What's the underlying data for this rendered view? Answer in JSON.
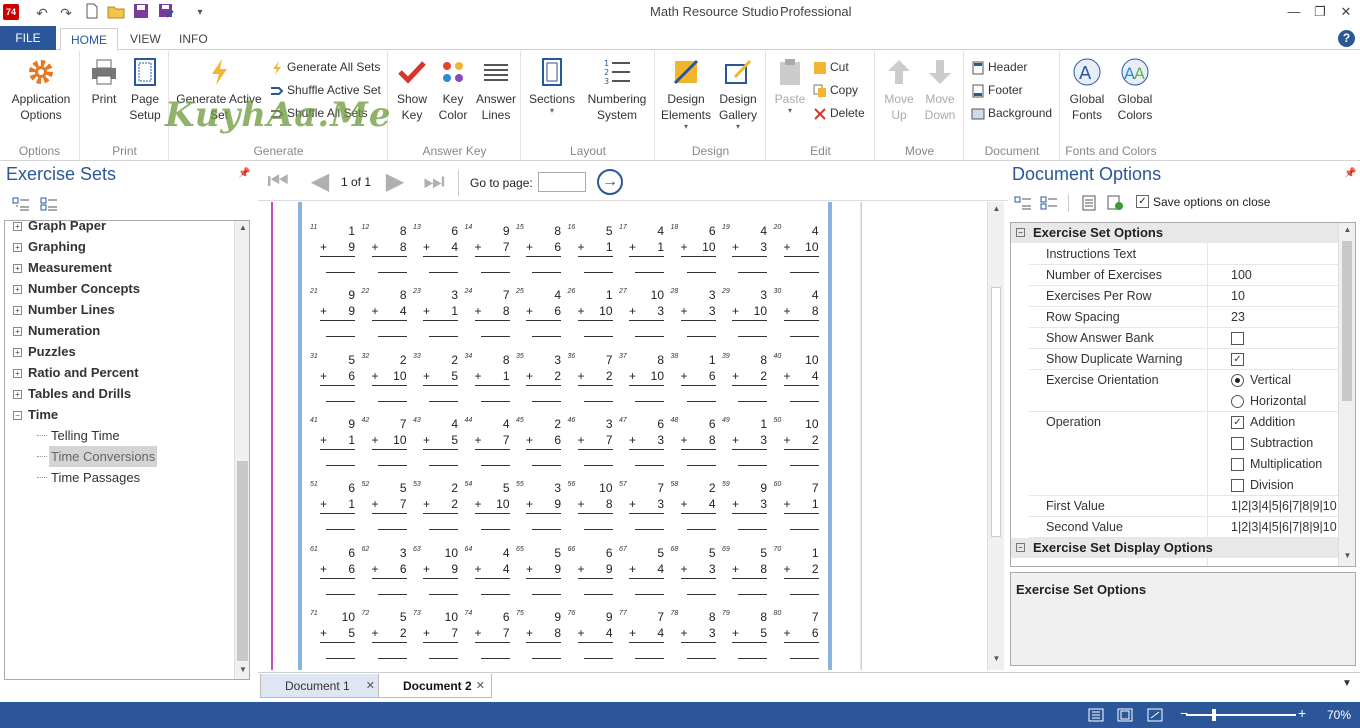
{
  "app": {
    "title": "Math Resource Studio",
    "edition": "Professional",
    "icon_text": "74",
    "window_controls": {
      "minimize": "—",
      "restore": "❐",
      "close": "✕"
    }
  },
  "ribbon_tabs": {
    "file": "FILE",
    "home": "HOME",
    "view": "VIEW",
    "info": "INFO"
  },
  "ribbon": {
    "options": {
      "label": "Options",
      "app_options": "Application Options"
    },
    "print": {
      "label": "Print",
      "print": "Print",
      "page_setup": "Page Setup"
    },
    "generate": {
      "label": "Generate",
      "generate_active": "Generate Active Set",
      "generate_all": "Generate All Sets",
      "shuffle_active": "Shuffle Active Set",
      "shuffle_all": "Shuffle All Sets"
    },
    "answer_key": {
      "label": "Answer Key",
      "show_key": "Show Key",
      "key_color": "Key Color",
      "answer_lines": "Answer Lines"
    },
    "layout": {
      "label": "Layout",
      "sections": "Sections",
      "numbering": "Numbering System"
    },
    "design": {
      "label": "Design",
      "elements": "Design Elements",
      "gallery": "Design Gallery"
    },
    "edit": {
      "label": "Edit",
      "paste": "Paste",
      "cut": "Cut",
      "copy": "Copy",
      "delete": "Delete"
    },
    "move": {
      "label": "Move",
      "up": "Move Up",
      "down": "Move Down"
    },
    "document": {
      "label": "Document",
      "header": "Header",
      "footer": "Footer",
      "background": "Background"
    },
    "fonts_colors": {
      "label": "Fonts and Colors",
      "global_fonts": "Global Fonts",
      "global_colors": "Global Colors"
    },
    "watermark": "KuyhAa.Me"
  },
  "left_panel": {
    "title": "Exercise Sets",
    "tree": [
      {
        "label": "Graph Paper",
        "type": "folder",
        "expander": "⊞"
      },
      {
        "label": "Graphing",
        "type": "folder",
        "expander": "⊞"
      },
      {
        "label": "Measurement",
        "type": "folder",
        "expander": "⊞"
      },
      {
        "label": "Number Concepts",
        "type": "folder",
        "expander": "⊞"
      },
      {
        "label": "Number Lines",
        "type": "folder",
        "expander": "⊞"
      },
      {
        "label": "Numeration",
        "type": "folder",
        "expander": "⊞"
      },
      {
        "label": "Puzzles",
        "type": "folder",
        "expander": "⊞"
      },
      {
        "label": "Ratio and Percent",
        "type": "folder",
        "expander": "⊞"
      },
      {
        "label": "Tables and Drills",
        "type": "folder",
        "expander": "⊞"
      },
      {
        "label": "Time",
        "type": "folder",
        "expander": "⊟"
      },
      {
        "label": "Telling Time",
        "type": "leaf"
      },
      {
        "label": "Time Conversions",
        "type": "leaf",
        "selected": true
      },
      {
        "label": "Time Passages",
        "type": "leaf"
      }
    ]
  },
  "nav": {
    "page_info": "1 of 1",
    "goto_label": "Go to page:",
    "goto_value": ""
  },
  "worksheet": {
    "operator": "+",
    "rows": [
      [
        [
          11,
          1,
          9
        ],
        [
          12,
          8,
          8
        ],
        [
          13,
          6,
          4
        ],
        [
          14,
          9,
          7
        ],
        [
          15,
          8,
          6
        ],
        [
          16,
          5,
          1
        ],
        [
          17,
          4,
          1
        ],
        [
          18,
          6,
          10
        ],
        [
          19,
          4,
          3
        ],
        [
          20,
          4,
          10
        ]
      ],
      [
        [
          21,
          9,
          9
        ],
        [
          22,
          8,
          4
        ],
        [
          23,
          3,
          1
        ],
        [
          24,
          7,
          8
        ],
        [
          25,
          4,
          6
        ],
        [
          26,
          1,
          10
        ],
        [
          27,
          10,
          3
        ],
        [
          28,
          3,
          3
        ],
        [
          29,
          3,
          10
        ],
        [
          30,
          4,
          8
        ]
      ],
      [
        [
          31,
          5,
          6
        ],
        [
          32,
          2,
          10
        ],
        [
          33,
          2,
          5
        ],
        [
          34,
          8,
          1
        ],
        [
          35,
          3,
          2
        ],
        [
          36,
          7,
          2
        ],
        [
          37,
          8,
          10
        ],
        [
          38,
          1,
          6
        ],
        [
          39,
          8,
          2
        ],
        [
          40,
          10,
          4
        ]
      ],
      [
        [
          41,
          9,
          1
        ],
        [
          42,
          7,
          10
        ],
        [
          43,
          4,
          5
        ],
        [
          44,
          4,
          7
        ],
        [
          45,
          2,
          6
        ],
        [
          46,
          3,
          7
        ],
        [
          47,
          6,
          3
        ],
        [
          48,
          6,
          8
        ],
        [
          49,
          1,
          3
        ],
        [
          50,
          10,
          2
        ]
      ],
      [
        [
          51,
          6,
          1
        ],
        [
          52,
          5,
          7
        ],
        [
          53,
          2,
          2
        ],
        [
          54,
          5,
          10
        ],
        [
          55,
          3,
          9
        ],
        [
          56,
          10,
          8
        ],
        [
          57,
          7,
          3
        ],
        [
          58,
          2,
          4
        ],
        [
          59,
          9,
          3
        ],
        [
          60,
          7,
          1
        ]
      ],
      [
        [
          61,
          6,
          6
        ],
        [
          62,
          3,
          6
        ],
        [
          63,
          10,
          9
        ],
        [
          64,
          4,
          4
        ],
        [
          65,
          5,
          9
        ],
        [
          66,
          6,
          9
        ],
        [
          67,
          5,
          4
        ],
        [
          68,
          5,
          3
        ],
        [
          69,
          5,
          8
        ],
        [
          70,
          1,
          2
        ]
      ],
      [
        [
          71,
          10,
          5
        ],
        [
          72,
          5,
          2
        ],
        [
          73,
          10,
          7
        ],
        [
          74,
          6,
          7
        ],
        [
          75,
          9,
          8
        ],
        [
          76,
          9,
          4
        ],
        [
          77,
          7,
          4
        ],
        [
          78,
          8,
          3
        ],
        [
          79,
          8,
          5
        ],
        [
          80,
          7,
          6
        ]
      ]
    ]
  },
  "doc_tabs": [
    {
      "label": "Document 1"
    },
    {
      "label": "Document 2",
      "active": true
    }
  ],
  "right_panel": {
    "title": "Document Options",
    "save_on_close": "Save options on close",
    "categories": {
      "exercise_set": "Exercise Set Options",
      "display": "Exercise Set Display Options"
    },
    "properties": {
      "instructions": {
        "name": "Instructions Text",
        "value": ""
      },
      "num_exercises": {
        "name": "Number of Exercises",
        "value": "100"
      },
      "per_row": {
        "name": "Exercises Per Row",
        "value": "10"
      },
      "row_spacing": {
        "name": "Row Spacing",
        "value": "23"
      },
      "answer_bank": {
        "name": "Show Answer Bank",
        "checked": false
      },
      "dup_warning": {
        "name": "Show Duplicate Warning",
        "checked": true
      },
      "orientation": {
        "name": "Exercise Orientation",
        "options": [
          "Vertical",
          "Horizontal"
        ],
        "selected": "Vertical"
      },
      "operation": {
        "name": "Operation",
        "options": [
          "Addition",
          "Subtraction",
          "Multiplication",
          "Division"
        ],
        "checked": [
          "Addition"
        ]
      },
      "first_value": {
        "name": "First Value",
        "value": "1|2|3|4|5|6|7|8|9|10"
      },
      "second_value": {
        "name": "Second Value",
        "value": "1|2|3|4|5|6|7|8|9|10"
      }
    },
    "description_title": "Exercise Set Options"
  },
  "status": {
    "zoom": "70%"
  },
  "colors": {
    "accent": "#2b579a",
    "margin_line": "#c24fc8",
    "page_border": "#8ab4e0"
  }
}
